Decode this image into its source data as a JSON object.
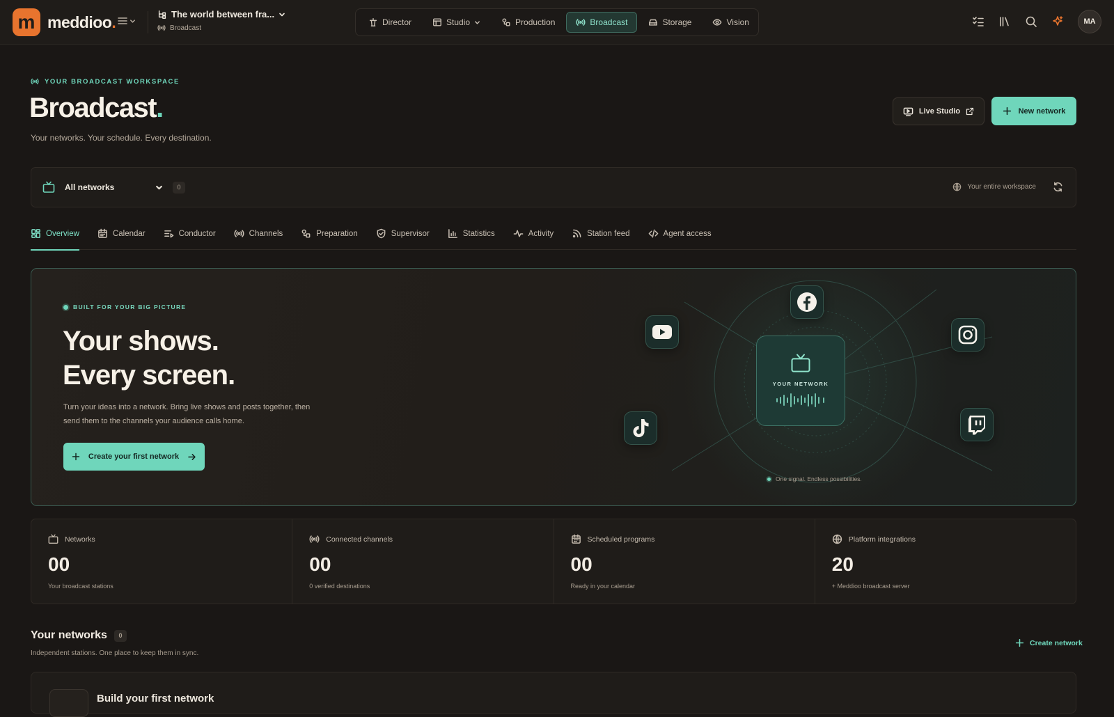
{
  "brand": {
    "logo_letter": "m",
    "name": "meddioo",
    "accent": "#e8742e"
  },
  "project": {
    "title": "The world between fra...",
    "subtitle": "Broadcast"
  },
  "nav": {
    "items": [
      {
        "label": "Director",
        "icon": "podium-icon"
      },
      {
        "label": "Studio",
        "icon": "layout-icon"
      },
      {
        "label": "Production",
        "icon": "shapes-icon"
      },
      {
        "label": "Broadcast",
        "icon": "broadcast-icon"
      },
      {
        "label": "Storage",
        "icon": "hard-drive-icon"
      },
      {
        "label": "Vision",
        "icon": "eye-icon"
      }
    ],
    "active": "Broadcast"
  },
  "user": {
    "initials": "MA"
  },
  "header": {
    "eyebrow": "YOUR BROADCAST WORKSPACE",
    "title": "Broadcast",
    "subtitle": "Your networks. Your schedule. Every destination.",
    "live_studio": "Live Studio",
    "new_network": "New network"
  },
  "filter": {
    "network": "All networks",
    "count": "0",
    "scope": "Your entire workspace"
  },
  "tabs": [
    {
      "label": "Overview",
      "icon": "grid-icon"
    },
    {
      "label": "Calendar",
      "icon": "calendar-icon"
    },
    {
      "label": "Conductor",
      "icon": "list-play-icon"
    },
    {
      "label": "Channels",
      "icon": "broadcast-icon"
    },
    {
      "label": "Preparation",
      "icon": "shapes-icon"
    },
    {
      "label": "Supervisor",
      "icon": "shield-icon"
    },
    {
      "label": "Statistics",
      "icon": "bar-chart-icon"
    },
    {
      "label": "Activity",
      "icon": "activity-icon"
    },
    {
      "label": "Station feed",
      "icon": "rss-icon"
    },
    {
      "label": "Agent access",
      "icon": "code-icon"
    }
  ],
  "active_tab": "Overview",
  "hero": {
    "eyebrow": "BUILT FOR YOUR BIG PICTURE",
    "line1": "Your shows.",
    "line2": "Every screen.",
    "body": "Turn your ideas into a network. Bring live shows and posts together, then send them to the channels your audience calls home.",
    "cta": "Create your first network",
    "core_label": "YOUR NETWORK",
    "caption": "One signal. Endless possibilities.",
    "platforms": [
      "facebook-icon",
      "youtube-icon",
      "instagram-icon",
      "tiktok-icon",
      "twitch-icon"
    ]
  },
  "stats": [
    {
      "label": "Networks",
      "value": "00",
      "note": "Your broadcast stations",
      "icon": "tv-icon"
    },
    {
      "label": "Connected channels",
      "value": "00",
      "note": "0 verified destinations",
      "icon": "broadcast-icon"
    },
    {
      "label": "Scheduled programs",
      "value": "00",
      "note": "Ready in your calendar",
      "icon": "calendar-icon"
    },
    {
      "label": "Platform integrations",
      "value": "20",
      "note": "+ Meddioo broadcast server",
      "icon": "globe-icon"
    }
  ],
  "networks": {
    "title": "Your networks",
    "count": "0",
    "subtitle": "Independent stations. One place to keep them in sync.",
    "create": "Create network",
    "card_title": "Build your first network"
  },
  "colors": {
    "accent": "#6fd6bb",
    "background": "#1a1715",
    "panel": "#1f1c19"
  }
}
